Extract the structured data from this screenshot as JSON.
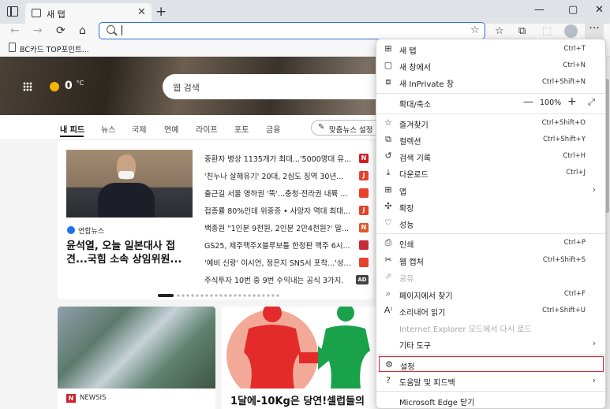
{
  "browser": {
    "tab_title": "새 탭",
    "tab_close": "✕",
    "newtab": "+",
    "minimize": "—",
    "maximize": "▢",
    "close": "✕"
  },
  "toolbar": {
    "back": "←",
    "forward": "→",
    "refresh": "⟳",
    "home": "⌂",
    "address_value": "",
    "address_placeholder": "",
    "star": "☆",
    "favorites_icon": "☆",
    "collections_icon": "⧉",
    "extension_icon": "⬚",
    "more": "···"
  },
  "favorites_bar": {
    "item": "BC카드 TOP포인트..."
  },
  "hero": {
    "temperature": "0",
    "unit": "°C",
    "search_placeholder": "웹 검색"
  },
  "news_nav": {
    "tabs": [
      "내 피드",
      "뉴스",
      "국제",
      "연예",
      "라이프",
      "포토",
      "금융"
    ],
    "personalize": "맞춤뉴스 설정"
  },
  "feed": {
    "source": "연합뉴스",
    "headline": "윤석열, 오늘 일본대사 접견...국힘 소속 상임위원...",
    "items": [
      {
        "text": "중환자 병상 1135개가 최대...'5000명대 유...",
        "badge": "N",
        "color": "#d01f26"
      },
      {
        "text": "'친누나 살해유기' 20대, 2심도 징역 30년...",
        "badge": "J",
        "color": "#e8412c"
      },
      {
        "text": "출근길 서울 영하권 '뚝'...충청·전라권 내륙 ...",
        "badge": "",
        "color": "#e8412c"
      },
      {
        "text": "접종률 80%인데 위중증 • 사망자 역대 최대...",
        "badge": "J",
        "color": "#e8412c"
      },
      {
        "text": "백종원 \"1인분 9천원, 2인분 2만4천원?' 말...",
        "badge": "N",
        "color": "#e2582b"
      },
      {
        "text": "GS25, 제주맥주X블루보틀 한정판 맥주 6시...",
        "badge": "",
        "color": "#c62b3a"
      },
      {
        "text": "'예비 신랑' 이시언, 정은지 SNS서 포착...'성...",
        "badge": "",
        "color": "#e8412c"
      },
      {
        "text": "주식투자 10번 중 9번 수익내는 공식 3가지.",
        "badge": "AD",
        "color": "#444444"
      }
    ]
  },
  "cards": {
    "card2_source": "NEWSIS",
    "card2_badge": "N",
    "card3_headline": "1달에-10Kg은 당연!셀럽들의"
  },
  "menu": {
    "new_tab": {
      "label": "새 탭",
      "shortcut": "Ctrl+T"
    },
    "new_window": {
      "label": "새 창에서",
      "shortcut": "Ctrl+N"
    },
    "inprivate": {
      "label": "새 InPrivate 창",
      "shortcut": "Ctrl+Shift+N"
    },
    "zoom": {
      "label": "확대/축소",
      "minus": "—",
      "value": "100%",
      "plus": "+",
      "fullscreen": "⤢"
    },
    "favorites": {
      "label": "즐겨찾기",
      "shortcut": "Ctrl+Shift+O"
    },
    "collections": {
      "label": "컬렉션",
      "shortcut": "Ctrl+Shift+Y"
    },
    "history": {
      "label": "검색 기록",
      "shortcut": "Ctrl+H"
    },
    "downloads": {
      "label": "다운로드",
      "shortcut": "Ctrl+J"
    },
    "apps": {
      "label": "앱"
    },
    "extensions": {
      "label": "확장"
    },
    "performance": {
      "label": "성능"
    },
    "print": {
      "label": "인쇄",
      "shortcut": "Ctrl+P"
    },
    "web_capture": {
      "label": "웹 캡처",
      "shortcut": "Ctrl+Shift+S"
    },
    "share": {
      "label": "공유"
    },
    "find": {
      "label": "페이지에서 찾기",
      "shortcut": "Ctrl+F"
    },
    "read_aloud": {
      "label": "소리내어 읽기",
      "shortcut": "Ctrl+Shift+U"
    },
    "ie_mode": {
      "label": "Internet Explorer 모드에서 다시 로드"
    },
    "more_tools": {
      "label": "기타 도구"
    },
    "settings": {
      "label": "설정"
    },
    "help": {
      "label": "도움말 및 피드백"
    },
    "close_edge": {
      "label": "Microsoft Edge 닫기"
    },
    "arrow": "›"
  }
}
